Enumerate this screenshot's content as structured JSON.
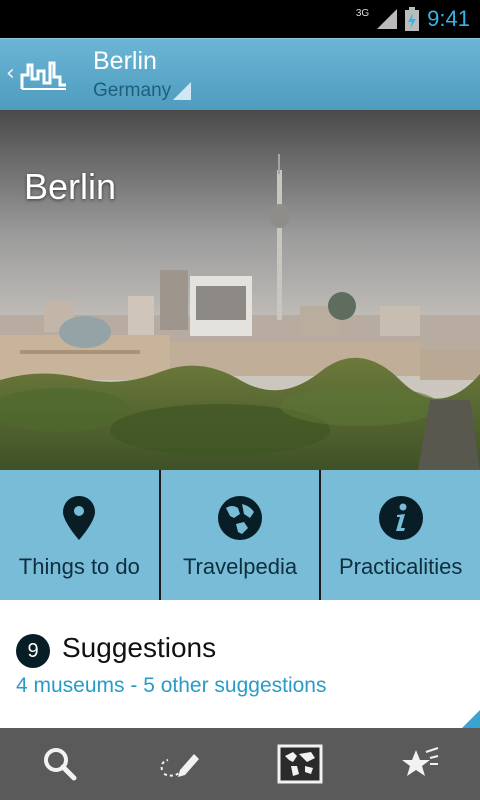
{
  "status_bar": {
    "network": "3G",
    "time": "9:41"
  },
  "action_bar": {
    "title": "Berlin",
    "subtitle": "Germany"
  },
  "hero": {
    "title": "Berlin"
  },
  "tiles": [
    {
      "label": "Things to do",
      "icon": "map-pin-icon"
    },
    {
      "label": "Travelpedia",
      "icon": "globe-icon"
    },
    {
      "label": "Practicalities",
      "icon": "info-icon"
    }
  ],
  "suggestions": {
    "count": "9",
    "title": "Suggestions",
    "subtitle": "4 museums - 5 other suggestions"
  },
  "bottom_nav": [
    {
      "icon": "search-icon"
    },
    {
      "icon": "edit-icon"
    },
    {
      "icon": "world-map-icon"
    },
    {
      "icon": "favorites-icon"
    }
  ],
  "colors": {
    "accent": "#33b5e5",
    "tile": "#79bcd7",
    "header": "#5da8c9",
    "link": "#2a9bc7"
  }
}
